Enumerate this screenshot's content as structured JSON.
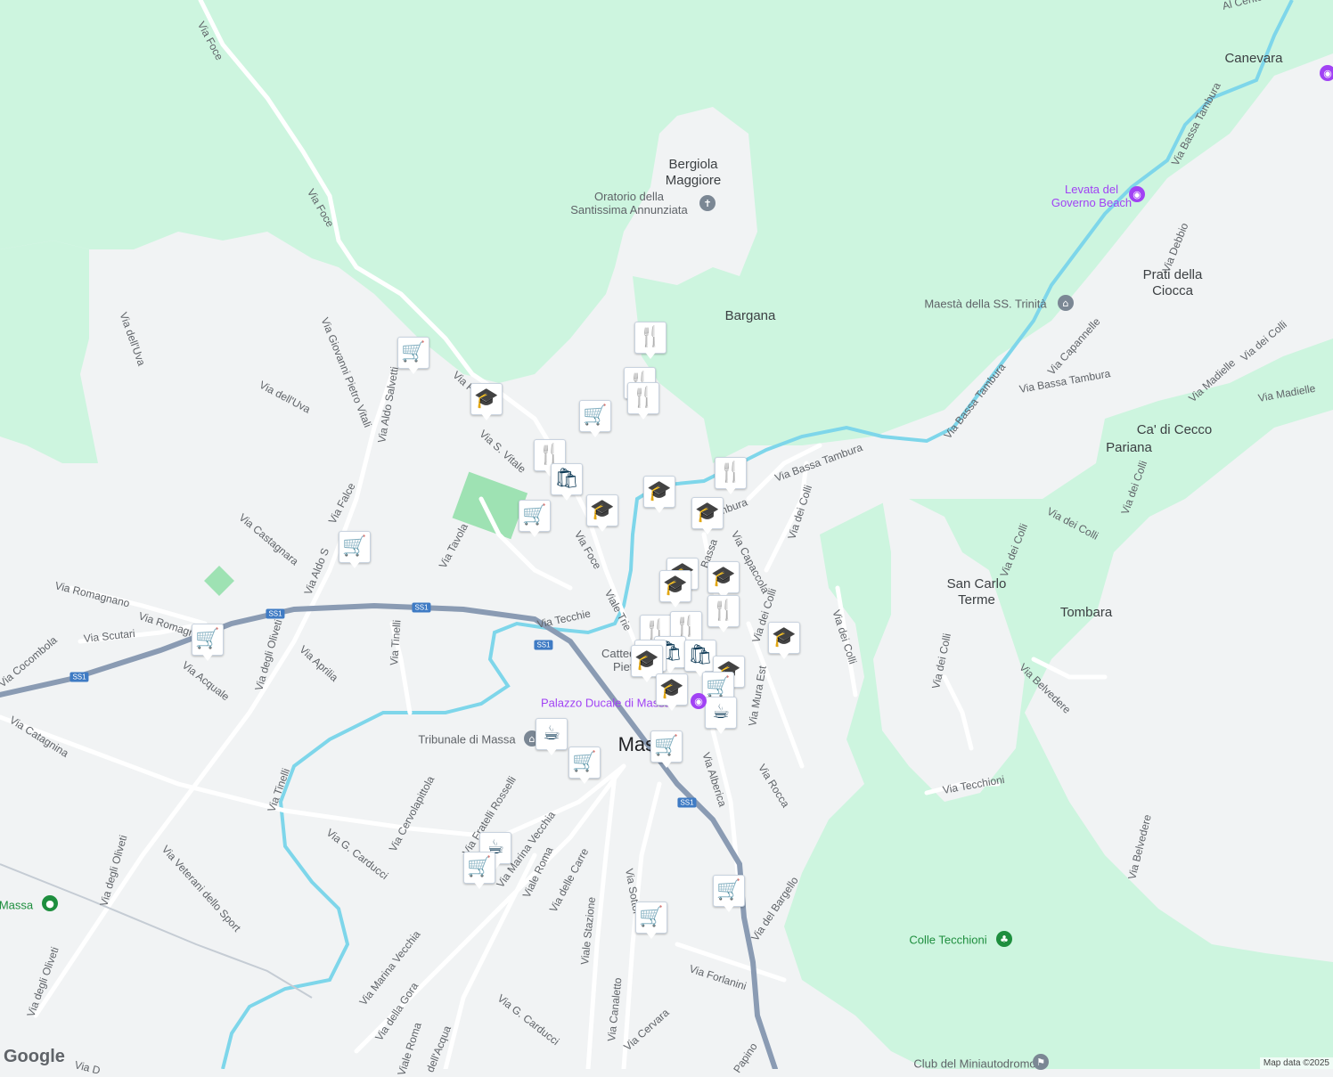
{
  "map": {
    "colors": {
      "land": "#f1f3f4",
      "forest": "#cdf5df",
      "water": "#7ed6ea",
      "road": "#ffffff",
      "highway": "#8a9bb3",
      "marker_icon": "#0f3b57",
      "poi_blue": "#1a73e8",
      "poi_purple": "#a142f4",
      "poi_green": "#1e8e3e"
    },
    "places": {
      "bergiola": "Bergiola\nMaggiore",
      "bargana": "Bargana",
      "canevara": "Canevara",
      "prati": "Prati della\nCiocca",
      "ca_di_cecco": "Ca' di Cecco",
      "pariana": "Pariana",
      "san_carlo": "San Carlo\nTerme",
      "tombara": "Tombara",
      "massa_city": "Massa"
    },
    "pois": {
      "oratorio": "Oratorio della\nSantissima Annunziata",
      "levata": "Levata del\nGoverno Beach",
      "maesta": "Maestà della SS. Trinità",
      "palazzo": "Palazzo Ducale di Massa",
      "tribunale": "Tribunale di Massa",
      "colle": "Colle Tecchioni",
      "club": "Club del Miniautodromo",
      "massa_station": "Massa",
      "cattedrale": "Cattedrale\nPietro"
    },
    "roads": {
      "via_foce_1": "Via Foce",
      "via_foce_2": "Via Foce",
      "via_foce_3": "Via Foce",
      "via_foce_4": "Via Foce",
      "via_dell_uva_1": "Via dell'Uva",
      "via_dell_uva_2": "Via dell'Uva",
      "via_gp_vitali": "Via Giovanni Pietro Vitali",
      "via_aldo_salvetti": "Via Aldo Salvetti",
      "via_s_vitale": "Via S. Vitale",
      "via_castagnara": "Via Castagnara",
      "via_falce": "Via Falce",
      "via_aldo_s": "Via Aldo S",
      "via_tavola": "Via Tavola",
      "via_romagnano_1": "Via Romagnano",
      "via_romagnano_2": "Via Romagnano",
      "via_scutari": "Via Scutari",
      "via_cocombola": "Via Cocombola",
      "via_acquale": "Via Acquale",
      "via_degli_oliveti_1": "Via degli Oliveti",
      "via_degli_oliveti_2": "Via degli Oliveti",
      "via_degli_oliveti_3": "Via degli Oliveti",
      "via_aprilia": "Via Aprilia",
      "via_tinelli_1": "Via Tinelli",
      "via_tinelli_2": "Via Tinelli",
      "via_tecchie": "Via Tecchie",
      "viale_trieste": "Viale Trie",
      "via_catagnina": "Via Catagnina",
      "via_cervolapittola": "Via Cervolapittola",
      "via_carducci_1": "Via G. Carducci",
      "via_carducci_2": "Via G. Carducci",
      "via_veterani": "Via Veterani dello Sport",
      "via_fratelli_rosselli": "Via Fratelli Rosselli",
      "via_marina_vecchia_1": "Via Marina Vecchia",
      "via_marina_vecchia_2": "Via Marina Vecchia",
      "viale_roma_1": "Viale Roma",
      "viale_roma_2": "Viale Roma",
      "via_delle_carre": "Via delle Carre",
      "viale_stazione": "Viale Stazione",
      "via_sottoripa": "Via Sottor",
      "via_canaletto": "Via Canaletto",
      "via_cervara": "Via Cervara",
      "via_forlanini": "Via Forlanini",
      "via_del_bargello": "Via del Bargello",
      "via_alberica": "Via Alberica",
      "via_rocca": "Via Rocca",
      "via_mura_est": "Via Mura Est",
      "via_dei_colli_1": "Via dei Colli",
      "via_dei_colli_2": "Via dei Colli",
      "via_dei_colli_3": "Via dei Colli",
      "via_dei_colli_4": "Via dei Colli",
      "via_dei_colli_5": "Via dei Colli",
      "via_dei_colli_6": "Via dei Colli",
      "via_dei_colli_7": "Via dei Colli",
      "via_dei_colli_8": "Via dei Colli",
      "via_capaccola": "Via Capaccola",
      "via_bassa_tambura_1": "Via Bassa Tambura",
      "via_bassa_tambura_2": "Via Bassa Tambura",
      "via_bassa_tambura_3": "Via Bassa Tambura",
      "via_bassa_tambura_4": "Via Bassa Tambura",
      "via_bassa_tambura_5": "ambura",
      "via_bassa_tambura_6": "Bassa",
      "via_capannelle": "Via Capannelle",
      "via_debbio": "Via Debbio",
      "via_madielle_1": "Via Madielle",
      "via_madielle_2": "Via Madielle",
      "via_belvedere_1": "Via Belvedere",
      "via_belvedere_2": "Via Belvedere",
      "via_tecchioni": "Via Tecchioni",
      "via_della_gora": "Via della Gora",
      "via_dell_acqua": "dell'Acqua",
      "via_papino": "Papino",
      "via_alto_centro": "Al Cento",
      "via_d": "Via D"
    },
    "shields": [
      "SS1",
      "SS1",
      "SS1",
      "SS1"
    ],
    "markers": [
      {
        "type": "restaurant",
        "icon": "🍴"
      },
      {
        "type": "restaurant",
        "icon": "🍴"
      },
      {
        "type": "restaurant",
        "icon": "🍴"
      },
      {
        "type": "shopping-cart",
        "icon": "🛒"
      },
      {
        "type": "school",
        "icon": "🎓"
      },
      {
        "type": "shopping-cart",
        "icon": "🛒"
      },
      {
        "type": "restaurant",
        "icon": "🍴"
      },
      {
        "type": "shopping-bag",
        "icon": "🛍"
      },
      {
        "type": "school",
        "icon": "🎓"
      },
      {
        "type": "school",
        "icon": "🎓"
      },
      {
        "type": "restaurant",
        "icon": "🍴"
      },
      {
        "type": "school",
        "icon": "🎓"
      },
      {
        "type": "shopping-cart",
        "icon": "🛒"
      },
      {
        "type": "shopping-cart",
        "icon": "🛒"
      },
      {
        "type": "shopping-cart",
        "icon": "🛒"
      },
      {
        "type": "school",
        "icon": "🎓"
      },
      {
        "type": "school",
        "icon": "🎓"
      },
      {
        "type": "school",
        "icon": "🎓"
      },
      {
        "type": "restaurant",
        "icon": "🍴"
      },
      {
        "type": "school",
        "icon": "🎓"
      },
      {
        "type": "restaurant",
        "icon": "🍴"
      },
      {
        "type": "restaurant",
        "icon": "🍴"
      },
      {
        "type": "shopping-bag",
        "icon": "🛍"
      },
      {
        "type": "school",
        "icon": "🎓"
      },
      {
        "type": "school",
        "icon": "🎓"
      },
      {
        "type": "shopping-bag",
        "icon": "🛍"
      },
      {
        "type": "school",
        "icon": "🎓"
      },
      {
        "type": "shopping-cart",
        "icon": "🛒"
      },
      {
        "type": "school",
        "icon": "🎓"
      },
      {
        "type": "cafe",
        "icon": "☕"
      },
      {
        "type": "cafe",
        "icon": "☕"
      },
      {
        "type": "shopping-cart",
        "icon": "🛒"
      },
      {
        "type": "shopping-cart",
        "icon": "🛒"
      },
      {
        "type": "cafe",
        "icon": "☕"
      },
      {
        "type": "shopping-cart",
        "icon": "🛒"
      },
      {
        "type": "shopping-cart",
        "icon": "🛒"
      },
      {
        "type": "shopping-cart",
        "icon": "🛒"
      }
    ],
    "logo": "Google",
    "attribution": "Map data ©2025"
  }
}
